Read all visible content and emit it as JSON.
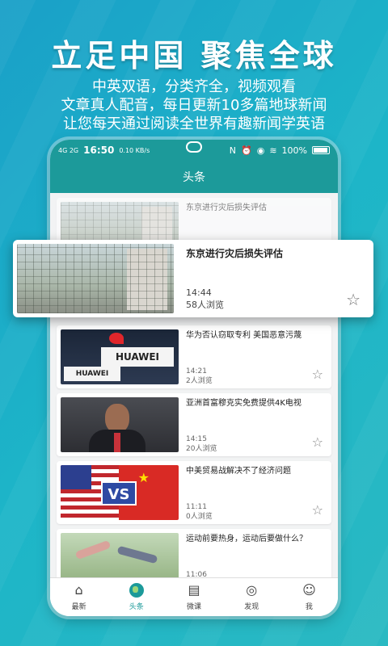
{
  "hero": {
    "title": "立足中国  聚焦全球",
    "line1": "中英双语，分类齐全，视频观看",
    "line2": "文章真人配音，每日更新10多篇地球新闻",
    "line3": "让您每天通过阅读全世界有趣新闻学英语"
  },
  "status_bar": {
    "network": "4G 2G",
    "time": "16:50",
    "speed": "0.10 KB/s",
    "icons": [
      "nfc-icon",
      "alarm-icon",
      "location-icon",
      "wifi-icon"
    ],
    "battery": "100%"
  },
  "header": {
    "title": "头条"
  },
  "articles": [
    {
      "title": "东京进行灾后损失评估",
      "time": "14:44",
      "views": "58人浏览"
    },
    {
      "title": "华为否认窃取专利 美国恶意污蔑",
      "time": "14:21",
      "views": "2人浏览"
    },
    {
      "title": "亚洲首富穆克实免费提供4K电视",
      "time": "14:15",
      "views": "20人浏览"
    },
    {
      "title": "中美贸易战解决不了经济问题",
      "time": "11:11",
      "views": "0人浏览"
    },
    {
      "title": "运动前要热身，运动后要做什么？",
      "time": "11:06",
      "views": ""
    }
  ],
  "thumb_text": {
    "huawei": "HUAWEI",
    "huawei2": "HUAWEI",
    "vs": "VS"
  },
  "bottom_nav": [
    {
      "label": "最新",
      "icon": "home-icon",
      "active": false
    },
    {
      "label": "头条",
      "icon": "globe-icon",
      "active": true
    },
    {
      "label": "微课",
      "icon": "book-icon",
      "active": false
    },
    {
      "label": "发现",
      "icon": "planet-icon",
      "active": false
    },
    {
      "label": "我",
      "icon": "user-icon",
      "active": false
    }
  ],
  "colors": {
    "accent": "#1c9a9a",
    "background": "#1db5c8"
  }
}
